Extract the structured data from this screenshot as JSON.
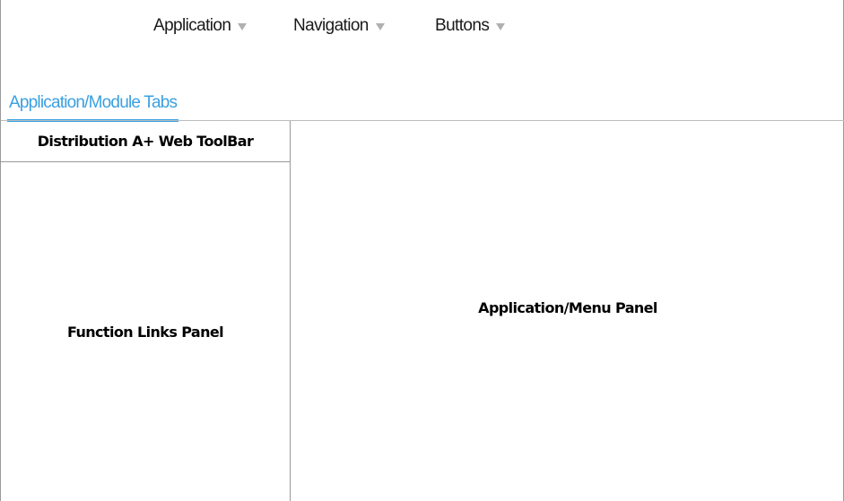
{
  "menubar": {
    "items": [
      {
        "label": "Application",
        "icon": "caret-down-icon"
      },
      {
        "label": "Navigation",
        "icon": "caret-down-icon"
      },
      {
        "label": "Buttons",
        "icon": "caret-down-icon"
      }
    ]
  },
  "tabs": [
    {
      "label": "Application/Module Tabs",
      "active": true
    }
  ],
  "left_panel": {
    "toolbar_title": "Distribution A+ Web ToolBar",
    "function_links_label": "Function Links Panel"
  },
  "main_panel": {
    "label": "Application/Menu Panel"
  },
  "colors": {
    "tab_accent": "#3aa0e0",
    "caret": "#b0b0b0",
    "border": "#9a9a9a"
  }
}
